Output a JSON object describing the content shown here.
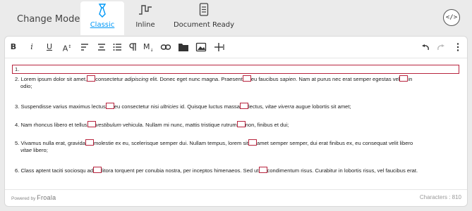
{
  "mode_bar": {
    "label": "Change Mode:",
    "tabs": [
      {
        "label": "Classic",
        "icon": "tie-icon",
        "active": true
      },
      {
        "label": "Inline",
        "icon": "wave-icon",
        "active": false
      },
      {
        "label": "Document Ready",
        "icon": "document-icon",
        "active": false
      }
    ],
    "code_button": "</>"
  },
  "toolbar": {
    "bold": "B",
    "italic": "i",
    "underline": "U",
    "font_size": "A",
    "markdown": "M"
  },
  "editor": {
    "line1": "1.",
    "p2": {
      "num": "2.",
      "t1": "Lorem ipsum dolor sit amet,",
      "t2": "consectetur",
      "t3": "adipiscing",
      "t4": "elit. Donec eget nunc magna. Praesent",
      "t5": "eu faucibus",
      "t6": "sapien",
      "t7": ". Nam at purus nec erat semper egestas vel",
      "t8": "in",
      "t9": "odio;"
    },
    "p3": {
      "num": "3.",
      "t1": "Suspendisse varius maximus lectus",
      "t2": "eu consectetur nisi",
      "t3": "ultricies",
      "t4": "id. Quisque luctus massa",
      "t5": "lectus,",
      "t6": "vitae viverra",
      "t7": "augue lobortis sit amet;"
    },
    "p4": {
      "num": "4.",
      "t1": "Nam rhoncus libero et tellus",
      "t2": "vestibulum",
      "t3": "vehicula. Nullam mi nunc, mattis tristique rutrum",
      "t4": "non, finibus et dui;"
    },
    "p5": {
      "num": "5.",
      "t1": "Vivamus nulla erat, gravida",
      "t2": "molestie ex eu, scelerisque semper dui. Nullam tempus, lorem sit",
      "t3": "amet semper semper, dui erat finibus ex, eu consequat velit libero",
      "t4": "vitae",
      "t5": "libero;"
    },
    "p6": {
      "num": "6.",
      "t1": "Class aptent taciti sociosqu ad",
      "t2": "litora torquent per conubia nostra, per inceptos himenaeos. Sed ut",
      "t3": "condimentum risus. Curabitur in lobortis risus, vel faucibus erat."
    }
  },
  "footer": {
    "powered_by": "Powered by",
    "brand": "Froala",
    "characters": "Characters : 810"
  },
  "colors": {
    "accent": "#0098f7",
    "highlight_border": "#b8243e"
  }
}
